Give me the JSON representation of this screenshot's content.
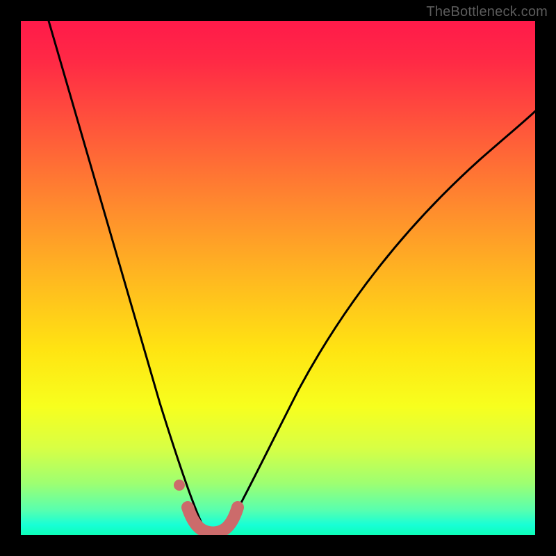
{
  "watermark": "TheBottleneck.com",
  "chart_data": {
    "type": "line",
    "title": "",
    "xlabel": "",
    "ylabel": "",
    "xlim": [
      0,
      100
    ],
    "ylim": [
      0,
      100
    ],
    "series": [
      {
        "name": "bottleneck-curve",
        "x": [
          5,
          10,
          15,
          20,
          25,
          28,
          30,
          32,
          34,
          35,
          36,
          38,
          40,
          45,
          50,
          55,
          60,
          70,
          80,
          90,
          100
        ],
        "y": [
          100,
          80,
          60,
          40,
          20,
          10,
          5,
          2,
          0,
          0,
          0,
          2,
          5,
          12,
          20,
          28,
          35,
          48,
          58,
          66,
          72
        ]
      }
    ],
    "annotations": [
      {
        "name": "optimum-band",
        "x_range": [
          31,
          39
        ],
        "y": 2,
        "style": "thick-pink"
      }
    ],
    "colors": {
      "curve": "#000000",
      "highlight": "#cc6b6b",
      "highlight_dot": "#cc6b6b"
    }
  }
}
